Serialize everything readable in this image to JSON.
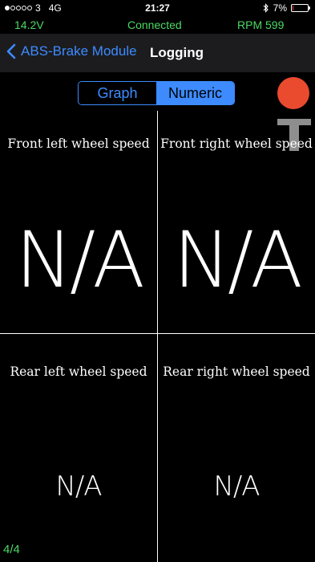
{
  "status_bar": {
    "carrier": "3",
    "network": "4G",
    "time": "21:27",
    "battery_percent_label": "7%",
    "battery_level": 0.07,
    "signal_bars_filled": 1,
    "signal_bars_total": 5
  },
  "connection": {
    "voltage": "14.2V",
    "status": "Connected",
    "rpm": "RPM 599"
  },
  "navbar": {
    "back_label": "ABS-Brake Module",
    "title": "Logging"
  },
  "segment": {
    "options": [
      "Graph",
      "Numeric"
    ],
    "selected": "Numeric"
  },
  "cells": [
    {
      "label": "Front left wheel speed",
      "value": "N/A"
    },
    {
      "label": "Front right wheel speed",
      "value": "N/A"
    },
    {
      "label": "Rear left wheel speed",
      "value": "N/A"
    },
    {
      "label": "Rear right wheel speed",
      "value": "N/A"
    }
  ],
  "page_indicator": "4/4",
  "colors": {
    "accent_blue": "#3d8bff",
    "status_green": "#4cd964",
    "record_red": "#ea4a2e",
    "battery_red": "#ff3b30"
  },
  "icons": [
    "back-chevron-icon",
    "bluetooth-icon",
    "battery-icon",
    "record-icon",
    "t-icon"
  ]
}
